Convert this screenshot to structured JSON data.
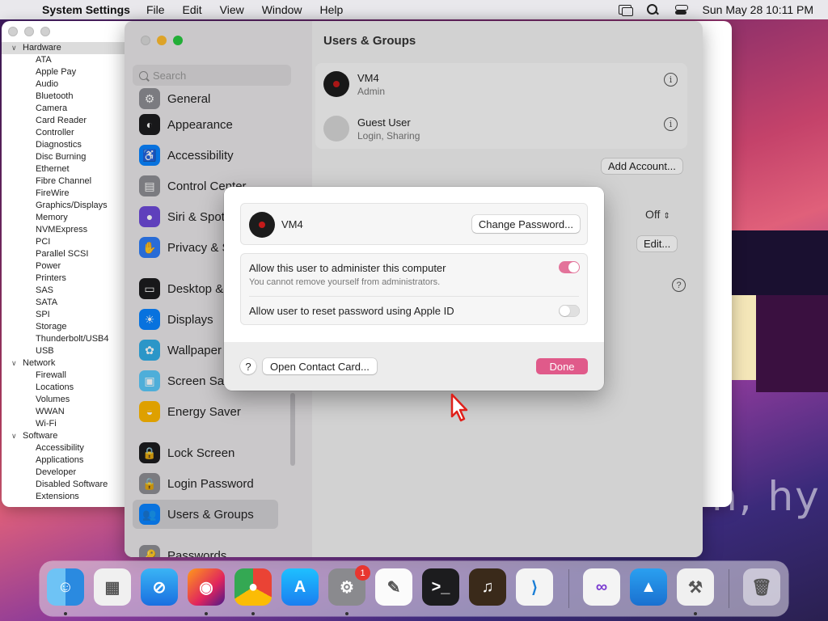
{
  "menubar": {
    "app_name": "System Settings",
    "menus": [
      "File",
      "Edit",
      "View",
      "Window",
      "Help"
    ],
    "datetime": "Sun May 28  10:11 PM"
  },
  "system_info": {
    "tree": [
      {
        "group": "Hardware",
        "items": [
          "ATA",
          "Apple Pay",
          "Audio",
          "Bluetooth",
          "Camera",
          "Card Reader",
          "Controller",
          "Diagnostics",
          "Disc Burning",
          "Ethernet",
          "Fibre Channel",
          "FireWire",
          "Graphics/Displays",
          "Memory",
          "NVMExpress",
          "PCI",
          "Parallel SCSI",
          "Power",
          "Printers",
          "SAS",
          "SATA",
          "SPI",
          "Storage",
          "Thunderbolt/USB4",
          "USB"
        ]
      },
      {
        "group": "Network",
        "items": [
          "Firewall",
          "Locations",
          "Volumes",
          "WWAN",
          "Wi-Fi"
        ]
      },
      {
        "group": "Software",
        "items": [
          "Accessibility",
          "Applications",
          "Developer",
          "Disabled Software",
          "Extensions"
        ]
      }
    ]
  },
  "desktop_art_text": "n, hy",
  "settings": {
    "title": "Users & Groups",
    "search_placeholder": "Search",
    "sidebar": [
      {
        "label": "General",
        "color": "#8e8e93",
        "glyph": "⚙"
      },
      {
        "label": "Appearance",
        "color": "#1c1c1e",
        "glyph": "◐"
      },
      {
        "label": "Accessibility",
        "color": "#0a84ff",
        "glyph": "♿"
      },
      {
        "label": "Control Center",
        "color": "#8e8e93",
        "glyph": "▤"
      },
      {
        "label": "Siri & Spotlight",
        "color": "#6e4ad8",
        "glyph": "●"
      },
      {
        "label": "Privacy & Security",
        "color": "#2e7cf6",
        "glyph": "✋"
      },
      {
        "label": "Desktop & Dock",
        "color": "#1c1c1e",
        "glyph": "▭"
      },
      {
        "label": "Displays",
        "color": "#0a84ff",
        "glyph": "☀"
      },
      {
        "label": "Wallpaper",
        "color": "#32ade6",
        "glyph": "✿"
      },
      {
        "label": "Screen Saver",
        "color": "#5ac8fa",
        "glyph": "▣"
      },
      {
        "label": "Energy Saver",
        "color": "#ffb800",
        "glyph": "◒"
      },
      {
        "label": "Lock Screen",
        "color": "#1c1c1e",
        "glyph": "🔒"
      },
      {
        "label": "Login Password",
        "color": "#8e8e93",
        "glyph": "🔒"
      },
      {
        "label": "Users & Groups",
        "color": "#0a84ff",
        "glyph": "👥"
      },
      {
        "label": "Passwords",
        "color": "#8e8e93",
        "glyph": "🔑"
      }
    ],
    "users": [
      {
        "name": "VM4",
        "role": "Admin"
      },
      {
        "name": "Guest User",
        "role": "Login, Sharing"
      }
    ],
    "add_account_label": "Add Account...",
    "auto_login_value": "Off",
    "edit_label": "Edit...",
    "help_label": "?"
  },
  "sheet": {
    "user_name": "VM4",
    "change_password_label": "Change Password...",
    "admin_option": {
      "label": "Allow this user to administer this computer",
      "sublabel": "You cannot remove yourself from administrators.",
      "enabled": true
    },
    "reset_option": {
      "label": "Allow user to reset password using Apple ID",
      "enabled": false
    },
    "help_label": "?",
    "contact_card_label": "Open Contact Card...",
    "done_label": "Done",
    "accent_color": "#e05a8a"
  },
  "dock": {
    "apps": [
      {
        "name": "finder-icon",
        "running": true
      },
      {
        "name": "launchpad-icon",
        "running": false
      },
      {
        "name": "safari-icon",
        "running": false
      },
      {
        "name": "firefox-icon",
        "running": true
      },
      {
        "name": "chrome-icon",
        "running": true
      },
      {
        "name": "app-store-icon",
        "running": false
      },
      {
        "name": "system-settings-icon",
        "running": true,
        "badge": "1"
      },
      {
        "name": "textedit-icon",
        "running": false
      },
      {
        "name": "terminal-icon",
        "running": false
      },
      {
        "name": "garageband-icon",
        "running": false
      },
      {
        "name": "vscode-icon",
        "running": false
      },
      {
        "name": "visual-studio-icon",
        "running": false
      },
      {
        "name": "keynote-icon",
        "running": false
      },
      {
        "name": "system-information-icon",
        "running": true
      },
      {
        "name": "trash-icon",
        "running": false
      }
    ]
  }
}
